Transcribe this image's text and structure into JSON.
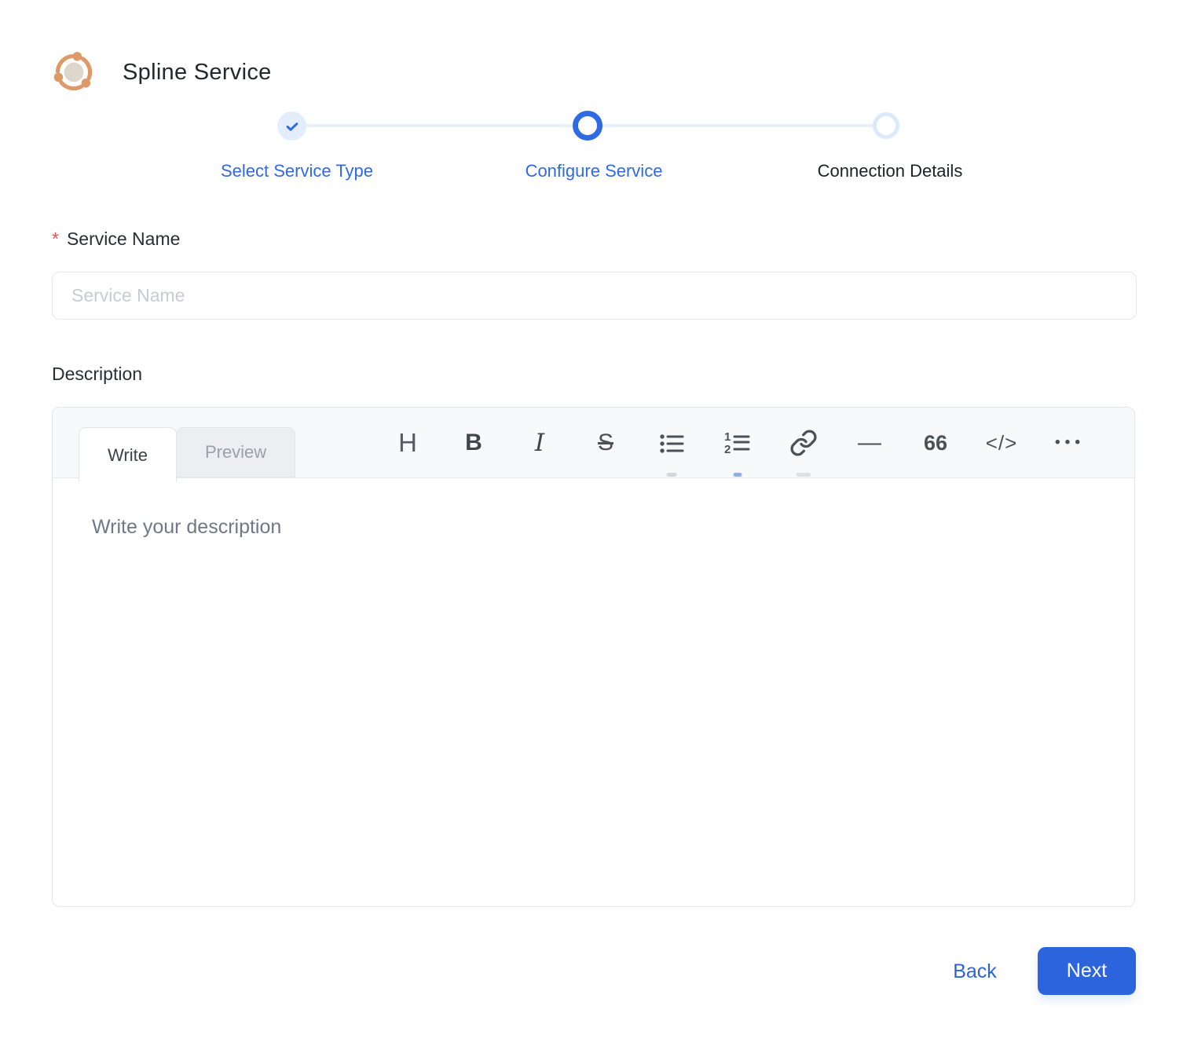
{
  "header": {
    "title": "Spline Service",
    "icon": "network-nodes-icon"
  },
  "stepper": {
    "steps": [
      {
        "label": "Select Service Type",
        "state": "completed",
        "icon": "check-icon"
      },
      {
        "label": "Configure Service",
        "state": "active",
        "icon": "circle-ring-icon"
      },
      {
        "label": "Connection Details",
        "state": "upcoming",
        "icon": "circle-outline-icon"
      }
    ]
  },
  "form": {
    "service_name": {
      "label": "Service Name",
      "required_marker": "*",
      "value": "",
      "placeholder": "Service Name"
    },
    "description": {
      "label": "Description",
      "editor": {
        "tabs": [
          {
            "label": "Write",
            "active": true
          },
          {
            "label": "Preview",
            "active": false
          }
        ],
        "toolbar": [
          {
            "name": "heading-icon",
            "glyph": "H"
          },
          {
            "name": "bold-icon",
            "glyph": "B"
          },
          {
            "name": "italic-icon",
            "glyph": "I"
          },
          {
            "name": "strikethrough-icon",
            "glyph": "S"
          },
          {
            "name": "unordered-list-icon",
            "glyph": ""
          },
          {
            "name": "ordered-list-icon",
            "glyph": ""
          },
          {
            "name": "link-icon",
            "glyph": ""
          },
          {
            "name": "horizontal-rule-icon",
            "glyph": "—"
          },
          {
            "name": "quote-icon",
            "glyph": "66"
          },
          {
            "name": "code-icon",
            "glyph": "</>"
          },
          {
            "name": "more-icon",
            "glyph": "•••"
          }
        ],
        "value": "",
        "placeholder": "Write your description"
      }
    }
  },
  "actions": {
    "back_label": "Back",
    "next_label": "Next"
  },
  "colors": {
    "accent_blue": "#2c64dd",
    "step_done_bg": "#e3edfb",
    "step_track": "#e9f1fd",
    "step_upcoming_ring": "#dbe9fc",
    "logo_orange": "#dd9a66",
    "logo_center": "#ddd6cb",
    "toolbar_bg": "#f7f9fb",
    "required_red": "#f0504f"
  }
}
